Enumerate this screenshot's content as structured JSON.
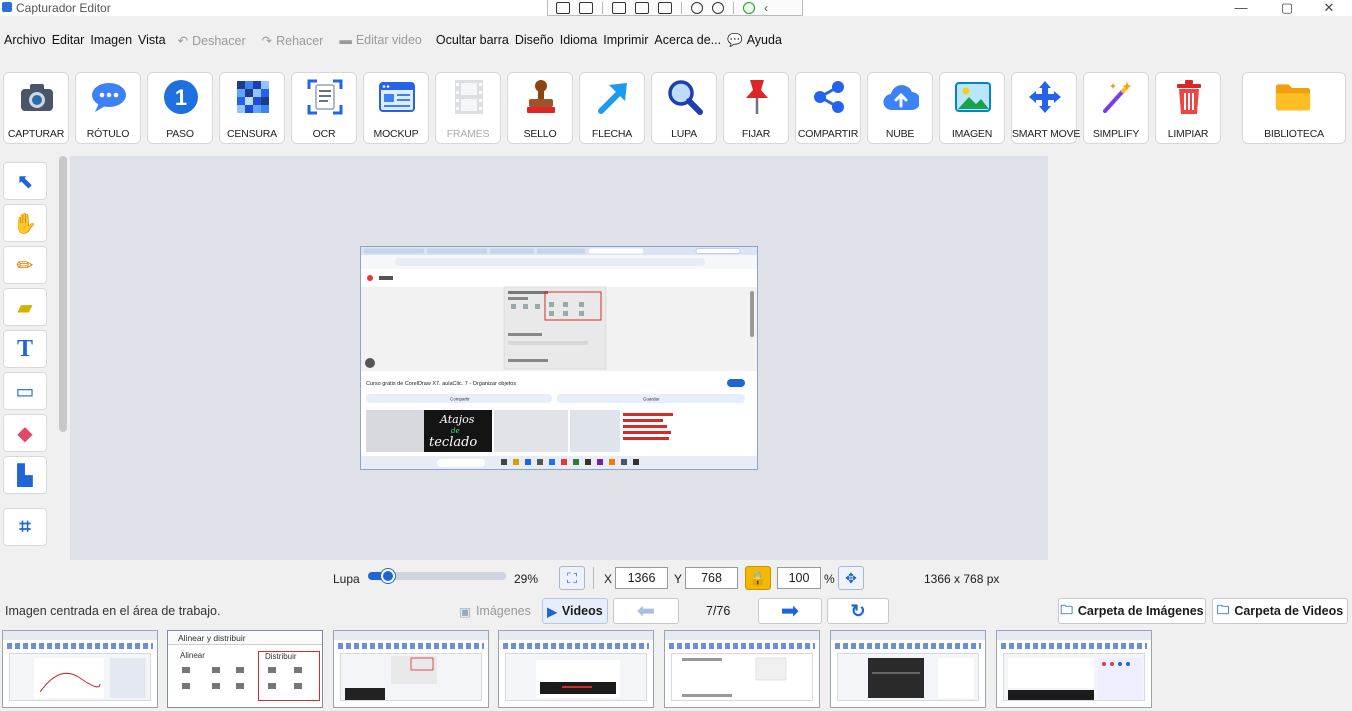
{
  "window": {
    "title": "Capturador Editor",
    "controls": [
      "—",
      "▢",
      "✕"
    ]
  },
  "menu": {
    "items": [
      "Archivo",
      "Editar",
      "Imagen",
      "Vista"
    ],
    "undo": "Deshacer",
    "redo": "Rehacer",
    "edit_video": "Editar video",
    "more": [
      "Ocultar barra",
      "Diseño",
      "Idioma",
      "Imprimir",
      "Acerca de..."
    ],
    "help": "Ayuda"
  },
  "toolbar": {
    "buttons": [
      {
        "label": "CAPTURAR",
        "icon": "camera-icon",
        "glyph": "📷"
      },
      {
        "label": "RÓTULO",
        "icon": "speech-bubble-icon",
        "glyph": "💬"
      },
      {
        "label": "PASO",
        "icon": "step-number-icon",
        "glyph": "1"
      },
      {
        "label": "CENSURA",
        "icon": "pixelate-icon",
        "glyph": "▦"
      },
      {
        "label": "OCR",
        "icon": "ocr-document-icon",
        "glyph": "▤"
      },
      {
        "label": "MOCKUP",
        "icon": "browser-window-icon",
        "glyph": "▭"
      },
      {
        "label": "FRAMES",
        "icon": "film-frames-icon",
        "glyph": "🎞"
      },
      {
        "label": "SELLO",
        "icon": "stamp-icon",
        "glyph": "♟"
      },
      {
        "label": "FLECHA",
        "icon": "arrow-icon",
        "glyph": "↗"
      },
      {
        "label": "LUPA",
        "icon": "magnifier-icon",
        "glyph": "🔍"
      },
      {
        "label": "FIJAR",
        "icon": "pin-icon",
        "glyph": "📌"
      },
      {
        "label": "COMPARTIR",
        "icon": "share-icon",
        "glyph": "⋖"
      },
      {
        "label": "NUBE",
        "icon": "cloud-upload-icon",
        "glyph": "☁"
      },
      {
        "label": "IMAGEN",
        "icon": "image-icon",
        "glyph": "🖼"
      },
      {
        "label": "SMART MOVE",
        "icon": "move-arrows-icon",
        "glyph": "✥"
      },
      {
        "label": "SIMPLIFY",
        "icon": "magic-wand-icon",
        "glyph": "✨"
      },
      {
        "label": "LIMPIAR",
        "icon": "trash-icon",
        "glyph": "🗑"
      },
      {
        "label": "BIBLIOTECA",
        "icon": "folder-icon",
        "glyph": "📁"
      }
    ]
  },
  "left_tools": [
    {
      "name": "select-tool",
      "glyph": "⬉"
    },
    {
      "name": "hand-tool",
      "glyph": "✋"
    },
    {
      "name": "pencil-tool",
      "glyph": "✏"
    },
    {
      "name": "highlighter-tool",
      "glyph": "🖍"
    },
    {
      "name": "text-tool",
      "glyph": "T"
    },
    {
      "name": "rectangle-tool",
      "glyph": "▭"
    },
    {
      "name": "eraser-tool",
      "glyph": "⌫"
    },
    {
      "name": "brush-tool",
      "glyph": "🖌"
    },
    {
      "name": "crop-tool",
      "glyph": "⌗"
    }
  ],
  "zoom": {
    "label": "Lupa",
    "percent": "29%",
    "level": 0.29,
    "x_label": "X",
    "x_value": "1366",
    "y_label": "Y",
    "y_value": "768",
    "scale_value": "100",
    "scale_unit": "%",
    "dimensions": "1366 x 768 px"
  },
  "status": {
    "message": "Imagen centrada en el área de trabajo."
  },
  "nav": {
    "images_tab": "Imágenes",
    "videos_tab": "Videos",
    "counter": "7/76",
    "images_folder": "Carpeta de Imágenes",
    "videos_folder": "Carpeta de Videos"
  },
  "canvas": {
    "screenshot_heading": "Curso gratis de CorelDraw X7. aulaClic. 7 - Organizar objetos",
    "share": "Compartir",
    "save": "Guardar",
    "overlay_text": "Atajos de teclado",
    "panel_title": "Alinear y distribuir"
  },
  "thumbnails": [
    {
      "title": ""
    },
    {
      "title": "Alinear y distribuir",
      "left": "Alinear",
      "right": "Distribuir"
    },
    {
      "title": ""
    },
    {
      "title": ""
    },
    {
      "title": ""
    },
    {
      "title": ""
    },
    {
      "title": ""
    }
  ],
  "colors": {
    "accent": "#1e66d8",
    "canvas_bg": "#dfe1e8",
    "highlight_red": "#d62b2b"
  }
}
